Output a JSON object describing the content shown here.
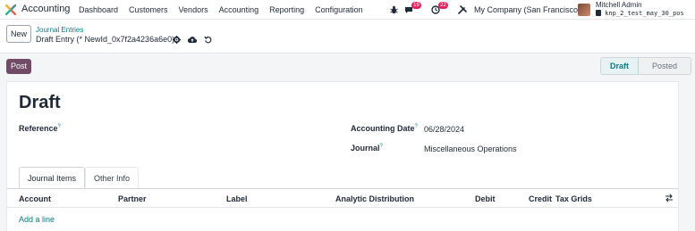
{
  "app": {
    "name": "Accounting",
    "menu": [
      "Dashboard",
      "Customers",
      "Vendors",
      "Accounting",
      "Reporting",
      "Configuration"
    ],
    "messages_count": "19",
    "activities_count": "22",
    "company": "My Company (San Francisco)",
    "user_name": "Mitchell Admin",
    "database": "knp_2_test_may_30_pos"
  },
  "control": {
    "new_label": "New",
    "breadcrumb_parent": "Journal Entries",
    "breadcrumb_current": "Draft Entry (* NewId_0x7f2a4236a6e0)"
  },
  "actions": {
    "post_label": "Post"
  },
  "statusbar": {
    "stages": [
      "Draft",
      "Posted"
    ],
    "active": "Draft"
  },
  "form": {
    "title": "Draft",
    "reference_label": "Reference",
    "reference_help": "?",
    "accounting_date_label": "Accounting Date",
    "accounting_date_help": "?",
    "accounting_date_value": "06/28/2024",
    "journal_label": "Journal",
    "journal_help": "?",
    "journal_value": "Miscellaneous Operations"
  },
  "tabs": [
    "Journal Items",
    "Other Info"
  ],
  "table": {
    "columns": [
      "Account",
      "Partner",
      "Label",
      "Analytic Distribution",
      "Debit",
      "Credit",
      "Tax Grids"
    ],
    "add_line_label": "Add a line"
  },
  "colors": {
    "brand": "#714b67",
    "link": "#017e84",
    "badge": "#e0245e"
  },
  "icons": [
    "odoo-logo-icon",
    "bug-icon",
    "chat-icon",
    "clock-icon",
    "tools-icon",
    "gear-icon",
    "cloud-upload-icon",
    "discard-icon",
    "column-toggle-icon"
  ]
}
